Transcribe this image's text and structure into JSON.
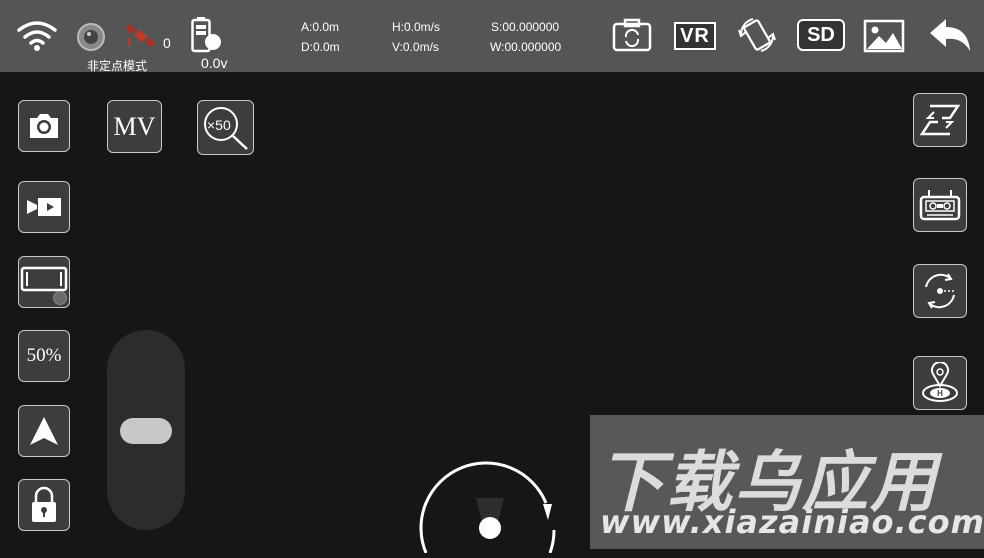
{
  "status": {
    "battery_voltage": "0.0v",
    "satellite_count": "0",
    "mode_label": "非定点模式"
  },
  "telemetry": {
    "altitude": "A:0.0m",
    "distance": "D:0.0m",
    "h_speed": "H:0.0m/s",
    "v_speed": "V:0.0m/s",
    "s_coord": "S:00.000000",
    "w_coord": "W:00.000000"
  },
  "toolbar": {
    "vr_label": "VR",
    "sd_label": "SD"
  },
  "left": {
    "mv_label": "MV",
    "zoom_label": "×50",
    "speed_label": "50%"
  },
  "watermark": {
    "title": "下载乌应用",
    "url": "www.xiazainiao.com"
  },
  "colors": {
    "topbar": "#555555",
    "background": "#161616",
    "button_border": "#c9c9c9"
  }
}
